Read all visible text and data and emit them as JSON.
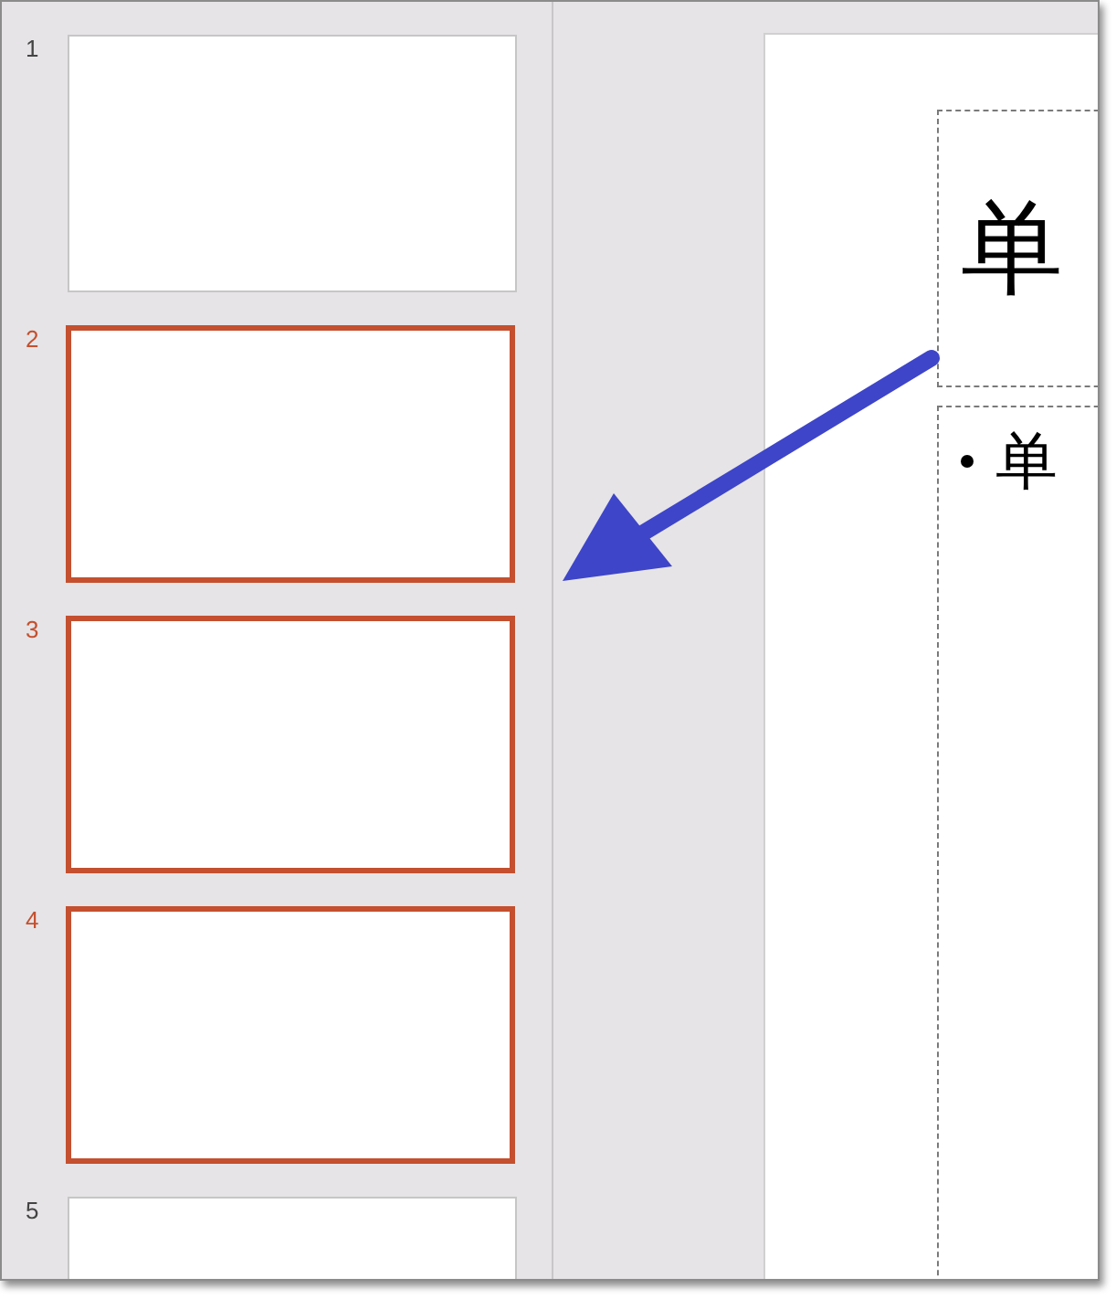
{
  "thumbnails": [
    {
      "number": "1",
      "selected": false
    },
    {
      "number": "2",
      "selected": true
    },
    {
      "number": "3",
      "selected": true
    },
    {
      "number": "4",
      "selected": true
    },
    {
      "number": "5",
      "selected": false
    }
  ],
  "slide": {
    "title": "单",
    "bullets": [
      "单"
    ]
  }
}
